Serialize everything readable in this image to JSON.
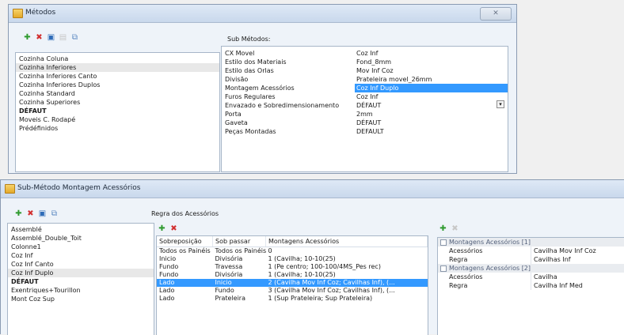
{
  "window1": {
    "title": "Métodos",
    "close": "✕",
    "methods": [
      "Cozinha Coluna",
      "Cozinha Inferiores",
      "Cozinha Inferiores Canto",
      "Cozinha Inferiores Duplos",
      "Cozinha Standard",
      "Cozinha Superiores",
      "DÉFAUT",
      "Moveis C. Rodapé",
      "Prédéfinidos"
    ],
    "submethods_label": "Sub Métodos:",
    "submethods": [
      {
        "name": "CX Movel",
        "value": "Coz Inf"
      },
      {
        "name": "Estilo dos Materiais",
        "value": "Fond_8mm"
      },
      {
        "name": "Estilo das Orlas",
        "value": "Mov Inf Coz"
      },
      {
        "name": "Divisão",
        "value": "Prateleira movel_26mm"
      },
      {
        "name": "Montagem Acessórios",
        "value": "Coz Inf Duplo"
      },
      {
        "name": "Furos Regulares",
        "value": "Coz Inf"
      },
      {
        "name": "Envazado e Sobredimensionamento",
        "value": "DÉFAUT"
      },
      {
        "name": "Porta",
        "value": "2mm"
      },
      {
        "name": "Gaveta",
        "value": "DÉFAUT"
      },
      {
        "name": "Peças Montadas",
        "value": "DEFAULT"
      }
    ]
  },
  "window2": {
    "title": "Sub-Método Montagem Acessórios",
    "submethods": [
      "Assemblé",
      "Assemblé_Double_Toit",
      "Colonne1",
      "Coz Inf",
      "Coz Inf Canto",
      "Coz Inf Duplo",
      "DÉFAUT",
      "Exentriques+Tourillon",
      "Mont Coz Sup"
    ],
    "rules_label": "Regra dos Acessórios",
    "rules_headers": [
      "Sobreposição",
      "Sob passar",
      "Montagens Acessórios"
    ],
    "rules": [
      [
        "Todos os Painéis",
        "Todos os Painéis",
        "0"
      ],
      [
        "Inicio",
        "Divisória",
        "1 (Cavilha; 10-10(25)"
      ],
      [
        "Fundo",
        "Travessa",
        "1 (Pe centro; 100-100/4MS_Pes rec)"
      ],
      [
        "Fundo",
        "Divisória",
        "1 (Cavilha; 10-10(25)"
      ],
      [
        "Lado",
        "Inicio",
        "2 (Cavilha Mov Inf Coz; Cavilhas Inf), (..."
      ],
      [
        "Lado",
        "Fundo",
        "3 (Cavilha Mov Inf Coz; Cavilhas Inf), (..."
      ],
      [
        "Lado",
        "Prateleira",
        "1 (Sup Prateleira; Sup Prateleira)"
      ]
    ],
    "props": [
      {
        "category": "Montagens Acessórios [1]",
        "rows": [
          {
            "key": "Acessórios",
            "value": "Cavilha Mov Inf Coz"
          },
          {
            "key": "Regra",
            "value": "Cavilhas Inf"
          }
        ]
      },
      {
        "category": "Montagens Acessórios [2]",
        "rows": [
          {
            "key": "Acessórios",
            "value": "Cavilha"
          },
          {
            "key": "Regra",
            "value": "Cavilha Inf Med"
          }
        ]
      }
    ]
  }
}
